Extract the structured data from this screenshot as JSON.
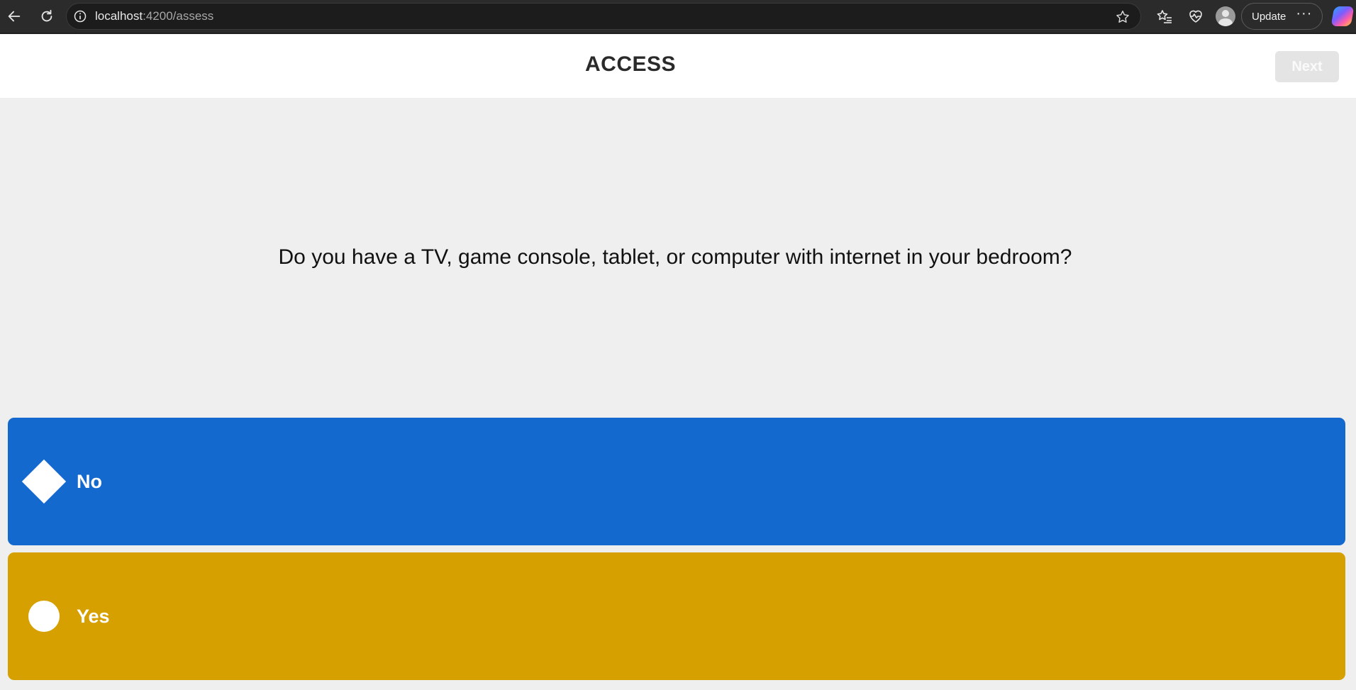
{
  "browser": {
    "url_host": "localhost",
    "url_path": ":4200/assess",
    "update_label": "Update",
    "more_label": "···"
  },
  "header": {
    "title": "ACCESS",
    "next_label": "Next"
  },
  "question": {
    "text": "Do you have a TV, game console, tablet, or computer with internet in your bedroom?"
  },
  "answers": [
    {
      "label": "No",
      "shape": "diamond",
      "color": "#1469cf"
    },
    {
      "label": "Yes",
      "shape": "circle",
      "color": "#d6a000"
    }
  ],
  "colors": {
    "page_bg": "#efefef",
    "header_bg": "#ffffff",
    "next_disabled_bg": "#e4e4e4"
  }
}
